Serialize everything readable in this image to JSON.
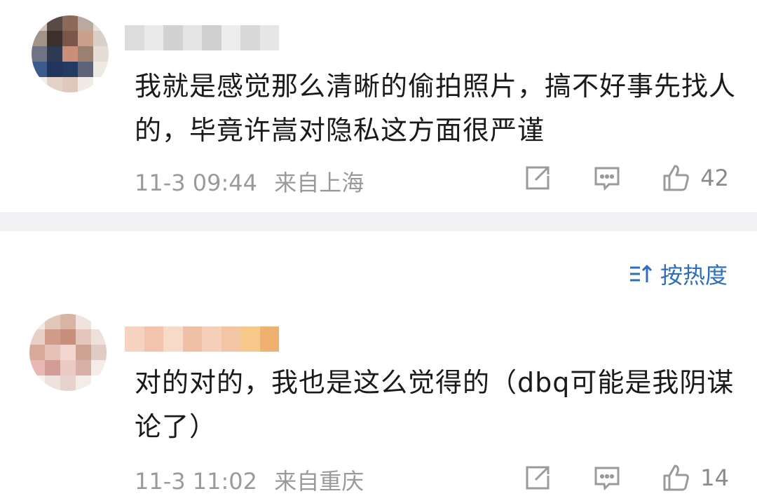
{
  "comments": [
    {
      "text": "我就是感觉那么清晰的偷拍照片，搞不好事先找人的，毕竟许嵩对隐私这方面很严谨",
      "time": "11-3 09:44",
      "location": "来自上海",
      "likes": "42",
      "avatar_colors": [
        "#cfc5bd",
        "#5a4a45",
        "#8b6a5a",
        "#b8aaa0",
        "#e8e0da",
        "#a39386",
        "#3d2f2c",
        "#7a5548",
        "#caa28c",
        "#d9d0c8",
        "#6e7485",
        "#2e3a52",
        "#c98f78",
        "#9a8070",
        "#e6ddd5",
        "#3c5a8c",
        "#1f355c",
        "#233a63",
        "#5d6478",
        "#efe9e4",
        "#f3eeea",
        "#e5d2c6",
        "#e0c8bc",
        "#f1ebe6",
        "#ffffff"
      ],
      "name_colors": [
        "#dcdcdc",
        "#eaeaea",
        "#d2d2d2",
        "#e4e4e4",
        "#cfcfcf",
        "#ededed",
        "#d8d8d8",
        "#e6e6e6"
      ]
    },
    {
      "text": "对的对的，我也是这么觉得的（dbq可能是我阴谋论了）",
      "time": "11-3 11:02",
      "location": "来自重庆",
      "likes": "14",
      "avatar_colors": [
        "#f3e8e4",
        "#e2c8bb",
        "#d8b4a4",
        "#f0e2dc",
        "#ffffff",
        "#e8d0c6",
        "#d29a88",
        "#c88f7c",
        "#e3c7bc",
        "#eee0db",
        "#d8a898",
        "#e6c2b6",
        "#f2d6cf",
        "#cfa393",
        "#e0ccc5",
        "#e8b8b4",
        "#d49c96",
        "#ebcac4",
        "#d8b0a8",
        "#f5ebe8",
        "#f8f2f0",
        "#efe2de",
        "#e6d2cc",
        "#f4ece9",
        "#ffffff"
      ],
      "name_colors": [
        "#f6d2c0",
        "#f2c4ae",
        "#f8dac8",
        "#f0c0a6",
        "#f5cfb8",
        "#f2c6a4",
        "#f6c88a",
        "#f0b070"
      ]
    }
  ],
  "sort": {
    "label": "按热度"
  },
  "colors": {
    "accent": "#2f6eb8",
    "meta": "#9a9a9a",
    "divider": "#f1f1f3"
  }
}
